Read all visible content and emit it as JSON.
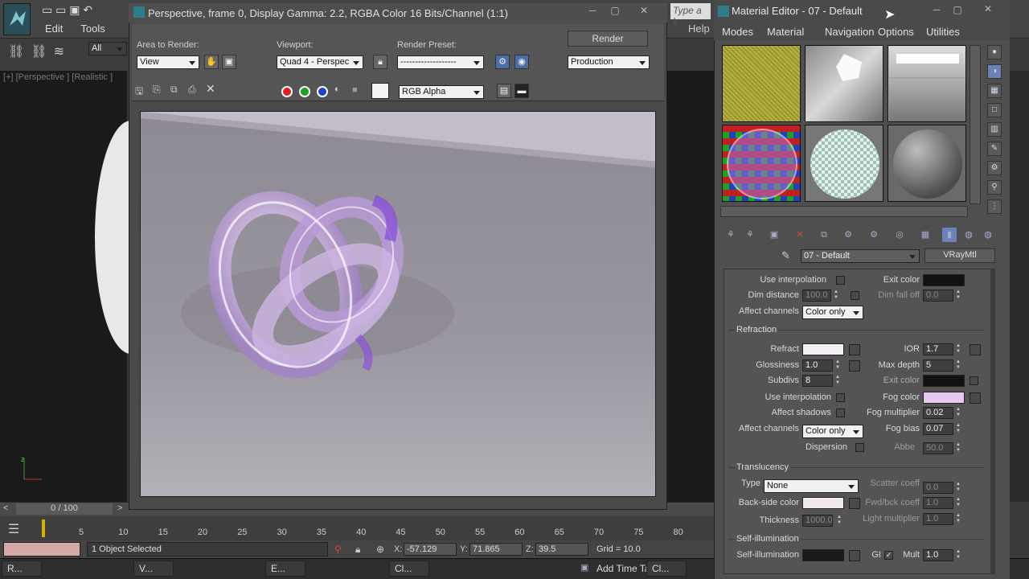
{
  "max": {
    "menu": [
      "Edit",
      "Tools"
    ],
    "search_placeholder": "Type a k",
    "help_label": "Help",
    "filter": "All",
    "viewport_label": "[+] [Perspective ] [Realistic ]",
    "timeline": "0 / 100",
    "ruler_ticks": [
      "5",
      "10",
      "15",
      "20",
      "25",
      "30",
      "35",
      "40",
      "45",
      "50",
      "55",
      "60",
      "65",
      "70",
      "75",
      "80"
    ],
    "status_text": "1 Object Selected",
    "x_label": "X:",
    "x_value": "-57.129",
    "y_label": "Y:",
    "y_value": "71.865",
    "z_label": "Z:",
    "z_value": "39.5",
    "grid": "Grid = 10.0",
    "add_time_tag": "Add Time Ta",
    "taskbar": [
      "R...",
      "V...",
      "E...",
      "Cl...",
      "Cl..."
    ]
  },
  "render_window": {
    "title": "Perspective, frame 0, Display Gamma: 2.2, RGBA Color 16 Bits/Channel (1:1)",
    "area_label": "Area to Render:",
    "area_value": "View",
    "viewport_label": "Viewport:",
    "viewport_value": "Quad 4 - Perspec",
    "preset_label": "Render Preset:",
    "preset_value": "-------------------",
    "render_button": "Render",
    "production": "Production",
    "channel": "RGB Alpha"
  },
  "material_editor": {
    "title": "Material Editor - 07 - Default",
    "menu": [
      "Modes",
      "Material",
      "Navigation",
      "Options",
      "Utilities"
    ],
    "material_name": "07 - Default",
    "material_type": "VRayMtl",
    "reflect_section": {
      "use_interpolation": "Use interpolation",
      "exit_color": "Exit color",
      "dim_distance": "Dim distance",
      "dim_distance_value": "100.0",
      "dim_falloff": "Dim fall off",
      "dim_falloff_value": "0.0",
      "affect_channels": "Affect channels",
      "affect_channels_value": "Color only"
    },
    "refraction": {
      "header": "Refraction",
      "refract": "Refract",
      "ior": "IOR",
      "ior_value": "1.7",
      "glossiness": "Glossiness",
      "glossiness_value": "1.0",
      "max_depth": "Max depth",
      "max_depth_value": "5",
      "subdivs": "Subdivs",
      "subdivs_value": "8",
      "exit_color": "Exit color",
      "use_interpolation": "Use interpolation",
      "fog_color": "Fog color",
      "affect_shadows": "Affect shadows",
      "fog_multiplier": "Fog multiplier",
      "fog_multiplier_value": "0.02",
      "affect_channels": "Affect channels",
      "affect_channels_value": "Color only",
      "fog_bias": "Fog bias",
      "fog_bias_value": "0.07",
      "dispersion": "Dispersion",
      "abbe": "Abbe",
      "abbe_value": "50.0"
    },
    "translucency": {
      "header": "Translucency",
      "type": "Type",
      "type_value": "None",
      "scatter_coeff": "Scatter coeff",
      "scatter_coeff_value": "0.0",
      "back_side_color": "Back-side color",
      "fwd_bck_coeff": "Fwd/bck coeff",
      "fwd_bck_coeff_value": "1.0",
      "thickness": "Thickness",
      "thickness_value": "1000.0",
      "light_multiplier": "Light multiplier",
      "light_multiplier_value": "1.0"
    },
    "self_illumination": {
      "header": "Self-illumination",
      "label": "Self-illumination",
      "gi": "GI",
      "mult": "Mult",
      "mult_value": "1.0"
    }
  },
  "colors": {
    "fog_color": "#e8c8f0",
    "refract_color": "#f2eef4",
    "back_side_color": "#f3eaf0",
    "exit_color": "#111111",
    "self_illum_color": "#1a1a1a"
  }
}
